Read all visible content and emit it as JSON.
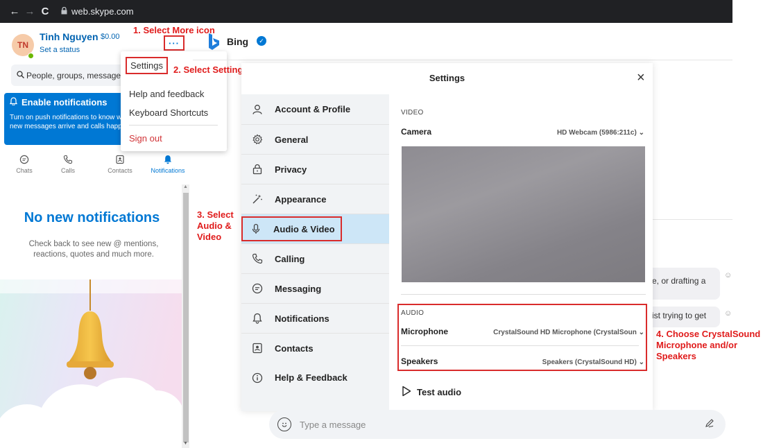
{
  "browser": {
    "url": "web.skype.com",
    "nav_back": "←",
    "nav_forward": "→",
    "nav_reload": "C"
  },
  "profile": {
    "initials": "TN",
    "name": "Tinh Nguyen",
    "balance": "$0.00",
    "status": "Set a status",
    "more_label": "···"
  },
  "search": {
    "placeholder": "People, groups, messages"
  },
  "notifications_banner": {
    "title": "Enable notifications",
    "description": "Turn on push notifications to know when new messages arrive and calls happen."
  },
  "tabs": [
    {
      "label": "Chats",
      "icon": "chat-icon"
    },
    {
      "label": "Calls",
      "icon": "phone-icon"
    },
    {
      "label": "Contacts",
      "icon": "contacts-icon"
    },
    {
      "label": "Notifications",
      "icon": "bell-icon"
    }
  ],
  "empty_state": {
    "title": "No new notifications",
    "description": "Check back to see new @ mentions, reactions, quotes and much more."
  },
  "dropdown": {
    "settings": "Settings",
    "help": "Help and feedback",
    "shortcuts": "Keyboard Shortcuts",
    "signout": "Sign out"
  },
  "annotations": {
    "step1": "1. Select More icon",
    "step2": "2. Select Settings",
    "step3_line1": "3. Select",
    "step3_line2": "Audio &",
    "step3_line3": "Video",
    "step4_line1": "4. Choose CrystalSound",
    "step4_line2": "Microphone and/or",
    "step4_line3": "Speakers"
  },
  "chat_header": {
    "name": "Bing"
  },
  "background_bubbles": {
    "b1": "e, or drafting a",
    "b2": "ist trying to get"
  },
  "settings_dialog": {
    "title": "Settings",
    "close": "×",
    "nav": [
      {
        "label": "Account & Profile",
        "icon": "person-icon"
      },
      {
        "label": "General",
        "icon": "gear-icon"
      },
      {
        "label": "Privacy",
        "icon": "lock-icon"
      },
      {
        "label": "Appearance",
        "icon": "magic-wand-icon"
      },
      {
        "label": "Audio & Video",
        "icon": "microphone-icon"
      },
      {
        "label": "Calling",
        "icon": "phone-icon"
      },
      {
        "label": "Messaging",
        "icon": "chat-icon"
      },
      {
        "label": "Notifications",
        "icon": "bell-icon"
      },
      {
        "label": "Contacts",
        "icon": "contacts-icon"
      },
      {
        "label": "Help & Feedback",
        "icon": "info-icon"
      }
    ],
    "video_section": "VIDEO",
    "camera_label": "Camera",
    "camera_value": "HD Webcam (5986:211c)",
    "audio_section": "AUDIO",
    "microphone_label": "Microphone",
    "microphone_value": "CrystalSound HD Microphone (CrystalSoun",
    "speakers_label": "Speakers",
    "speakers_value": "Speakers (CrystalSound HD)",
    "test_audio": "Test audio"
  },
  "composer": {
    "placeholder": "Type a message"
  }
}
